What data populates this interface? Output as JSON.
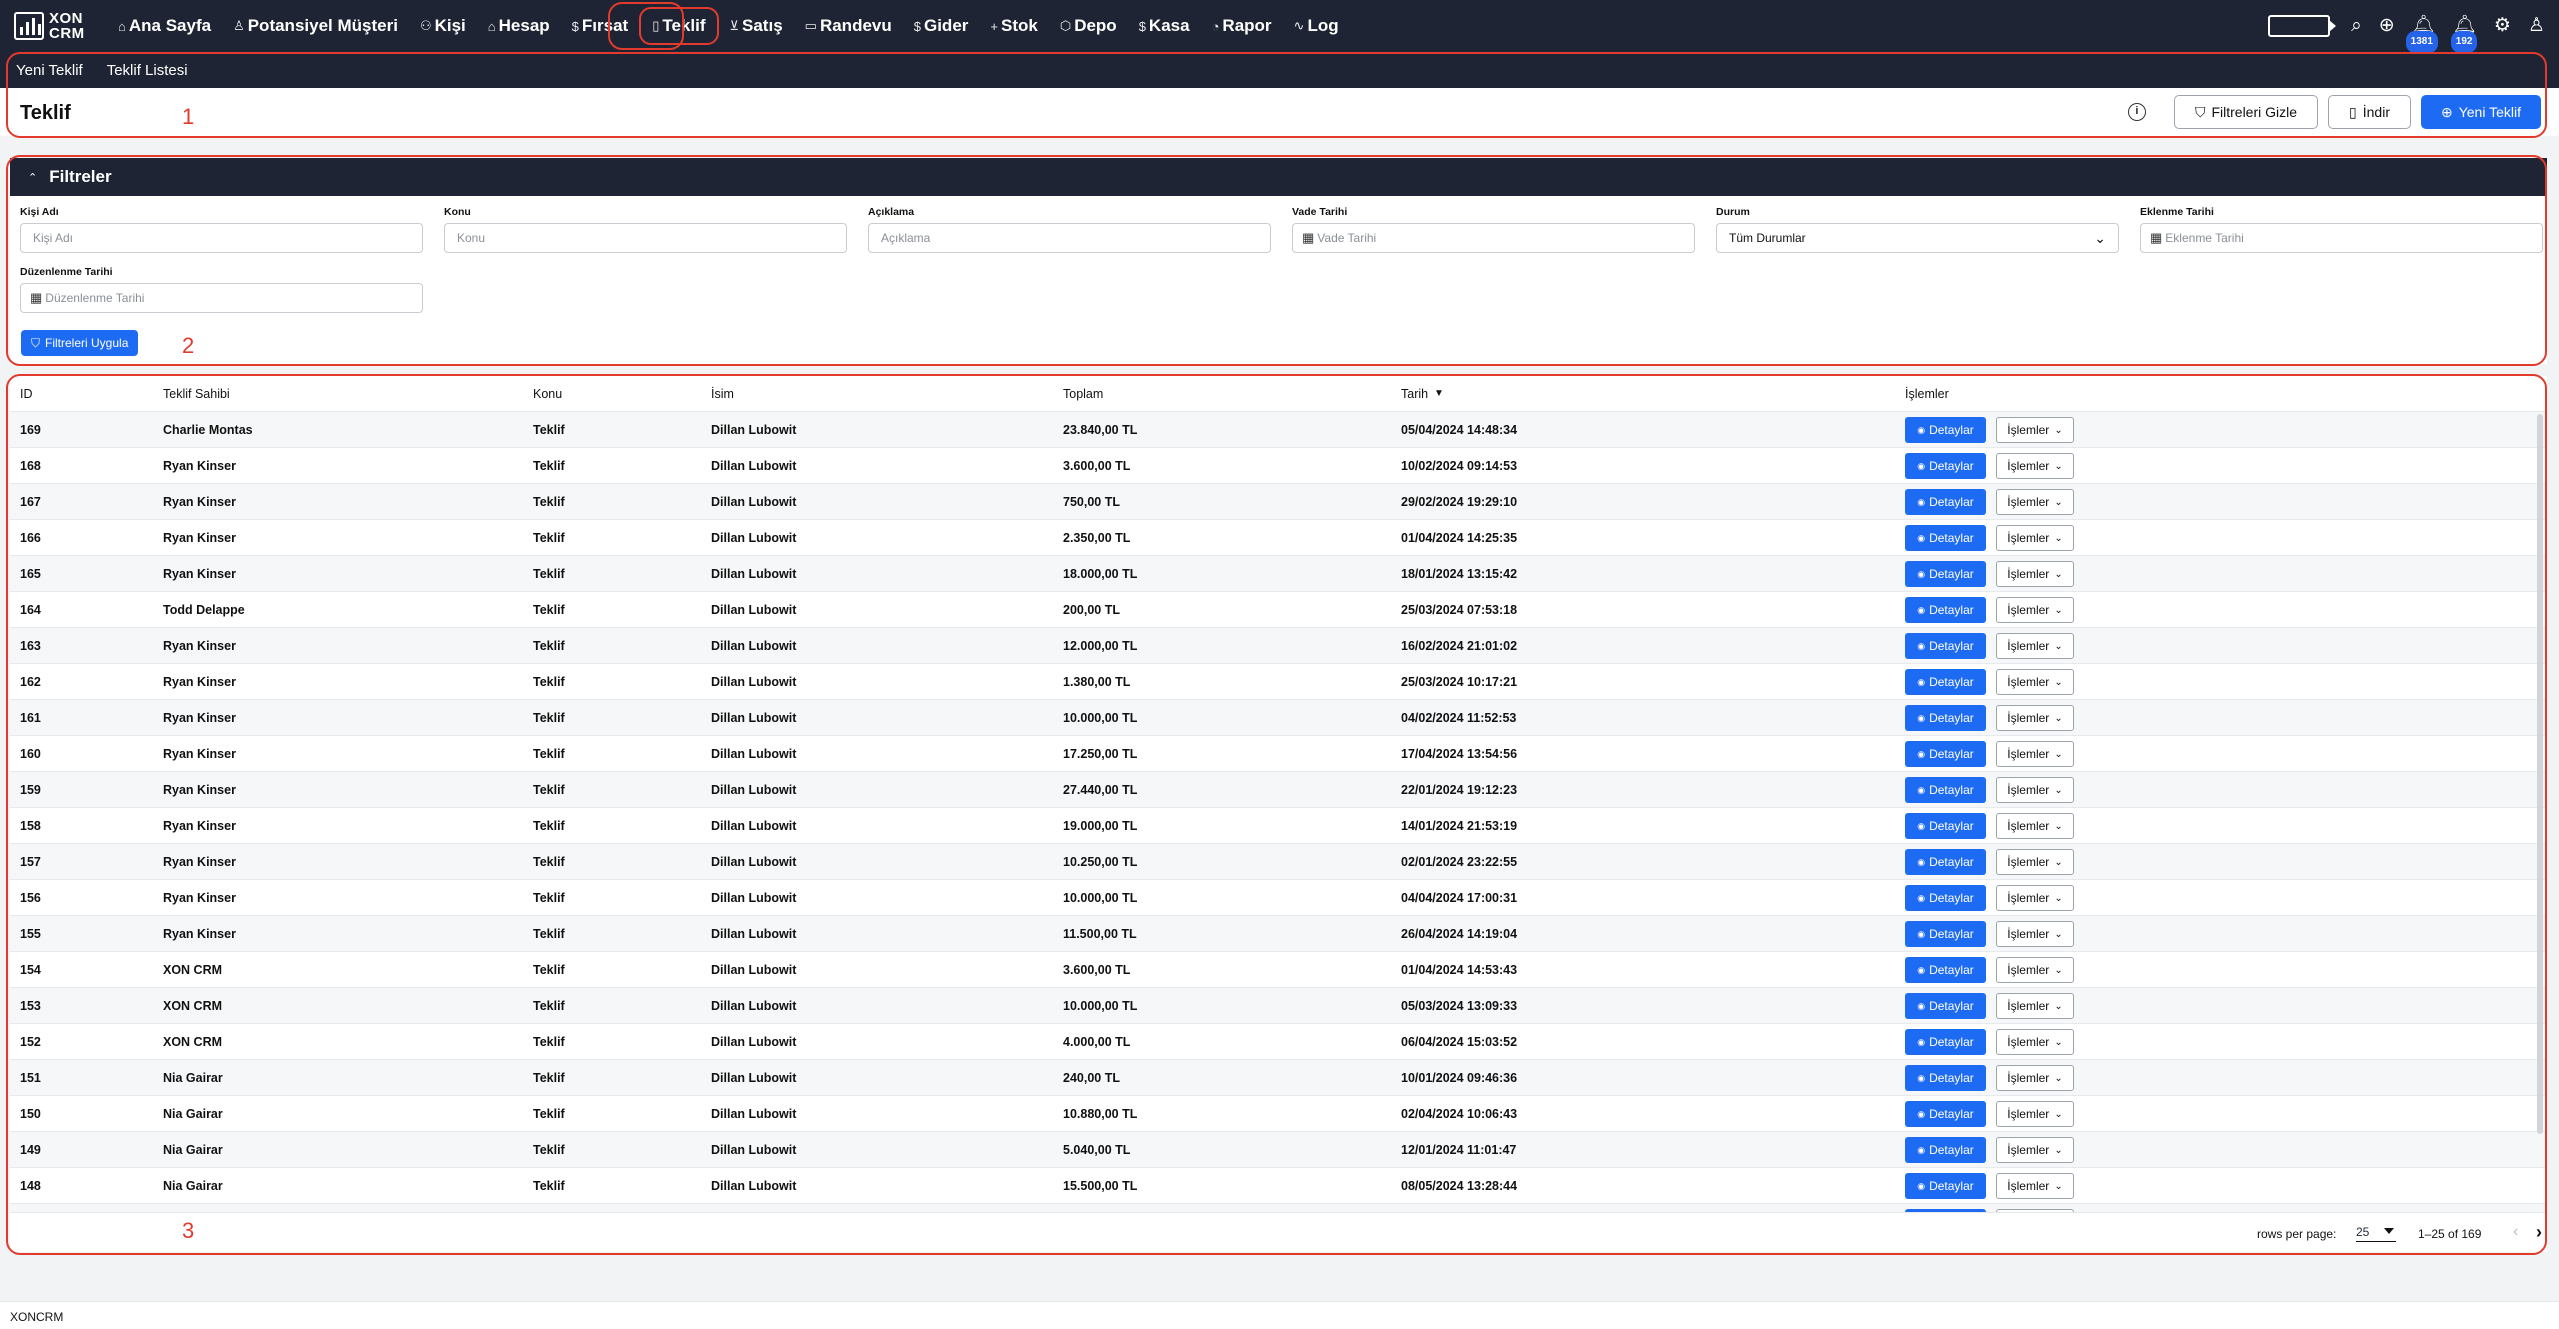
{
  "app": {
    "logo_text": "XON CRM",
    "logo_line1": "XON",
    "logo_line2": "CRM",
    "footer": "XONCRM"
  },
  "nav": [
    {
      "label": "Ana Sayfa",
      "icon": "home-icon",
      "glyph": "⌂"
    },
    {
      "label": "Potansiyel Müşteri",
      "icon": "user-icon",
      "glyph": "♙"
    },
    {
      "label": "Kişi",
      "icon": "users-icon",
      "glyph": "⚇"
    },
    {
      "label": "Hesap",
      "icon": "building-icon",
      "glyph": "⌂"
    },
    {
      "label": "Fırsat",
      "icon": "dollar-icon",
      "glyph": "$"
    },
    {
      "label": "Teklif",
      "icon": "document-icon",
      "glyph": "▯",
      "active": true
    },
    {
      "label": "Satış",
      "icon": "cart-icon",
      "glyph": "⊻"
    },
    {
      "label": "Randevu",
      "icon": "calendar-icon",
      "glyph": "▭"
    },
    {
      "label": "Gider",
      "icon": "dollar-icon",
      "glyph": "$"
    },
    {
      "label": "Stok",
      "icon": "plus-icon",
      "glyph": "+"
    },
    {
      "label": "Depo",
      "icon": "box-icon",
      "glyph": "⬡"
    },
    {
      "label": "Kasa",
      "icon": "dollar-icon",
      "glyph": "$"
    },
    {
      "label": "Rapor",
      "icon": "chart-icon",
      "glyph": "◔"
    },
    {
      "label": "Log",
      "icon": "activity-icon",
      "glyph": "∿"
    }
  ],
  "nav_right": {
    "badge1": "1381",
    "badge2": "192"
  },
  "subnav": {
    "new_quote": "Yeni Teklif",
    "quote_list": "Teklif Listesi"
  },
  "titlebar": {
    "title": "Teklif",
    "hide_filters": "Filtreleri Gizle",
    "download": "İndir",
    "new_quote": "Yeni Teklif"
  },
  "annotations": {
    "n1": "1",
    "n2": "2",
    "n3": "3"
  },
  "filters": {
    "title": "Filtreler",
    "fields": [
      {
        "label": "Kişi Adı",
        "placeholder": "Kişi Adı"
      },
      {
        "label": "Konu",
        "placeholder": "Konu"
      },
      {
        "label": "Açıklama",
        "placeholder": "Açıklama"
      },
      {
        "label": "Vade Tarihi",
        "placeholder": "Vade Tarihi",
        "date": true
      },
      {
        "label": "Durum",
        "value": "Tüm Durumlar",
        "select": true
      },
      {
        "label": "Eklenme Tarihi",
        "placeholder": "Eklenme Tarihi",
        "date": true
      },
      {
        "label": "Düzenlenme Tarihi",
        "placeholder": "Düzenlenme Tarihi",
        "date": true
      }
    ],
    "apply": "Filtreleri Uygula"
  },
  "table": {
    "columns": [
      "ID",
      "Teklif Sahibi",
      "Konu",
      "İsim",
      "Toplam",
      "Tarih",
      "İşlemler"
    ],
    "details_label": "Detaylar",
    "ops_label": "İşlemler",
    "rows": [
      [
        "169",
        "Charlie Montas",
        "Teklif",
        "Dillan Lubowit",
        "23.840,00 TL",
        "05/04/2024 14:48:34"
      ],
      [
        "168",
        "Ryan Kinser",
        "Teklif",
        "Dillan Lubowit",
        "3.600,00 TL",
        "10/02/2024 09:14:53"
      ],
      [
        "167",
        "Ryan Kinser",
        "Teklif",
        "Dillan Lubowit",
        "750,00 TL",
        "29/02/2024 19:29:10"
      ],
      [
        "166",
        "Ryan Kinser",
        "Teklif",
        "Dillan Lubowit",
        "2.350,00 TL",
        "01/04/2024 14:25:35"
      ],
      [
        "165",
        "Ryan Kinser",
        "Teklif",
        "Dillan Lubowit",
        "18.000,00 TL",
        "18/01/2024 13:15:42"
      ],
      [
        "164",
        "Todd Delappe",
        "Teklif",
        "Dillan Lubowit",
        "200,00 TL",
        "25/03/2024 07:53:18"
      ],
      [
        "163",
        "Ryan Kinser",
        "Teklif",
        "Dillan Lubowit",
        "12.000,00 TL",
        "16/02/2024 21:01:02"
      ],
      [
        "162",
        "Ryan Kinser",
        "Teklif",
        "Dillan Lubowit",
        "1.380,00 TL",
        "25/03/2024 10:17:21"
      ],
      [
        "161",
        "Ryan Kinser",
        "Teklif",
        "Dillan Lubowit",
        "10.000,00 TL",
        "04/02/2024 11:52:53"
      ],
      [
        "160",
        "Ryan Kinser",
        "Teklif",
        "Dillan Lubowit",
        "17.250,00 TL",
        "17/04/2024 13:54:56"
      ],
      [
        "159",
        "Ryan Kinser",
        "Teklif",
        "Dillan Lubowit",
        "27.440,00 TL",
        "22/01/2024 19:12:23"
      ],
      [
        "158",
        "Ryan Kinser",
        "Teklif",
        "Dillan Lubowit",
        "19.000,00 TL",
        "14/01/2024 21:53:19"
      ],
      [
        "157",
        "Ryan Kinser",
        "Teklif",
        "Dillan Lubowit",
        "10.250,00 TL",
        "02/01/2024 23:22:55"
      ],
      [
        "156",
        "Ryan Kinser",
        "Teklif",
        "Dillan Lubowit",
        "10.000,00 TL",
        "04/04/2024 17:00:31"
      ],
      [
        "155",
        "Ryan Kinser",
        "Teklif",
        "Dillan Lubowit",
        "11.500,00 TL",
        "26/04/2024 14:19:04"
      ],
      [
        "154",
        "XON CRM",
        "Teklif",
        "Dillan Lubowit",
        "3.600,00 TL",
        "01/04/2024 14:53:43"
      ],
      [
        "153",
        "XON CRM",
        "Teklif",
        "Dillan Lubowit",
        "10.000,00 TL",
        "05/03/2024 13:09:33"
      ],
      [
        "152",
        "XON CRM",
        "Teklif",
        "Dillan Lubowit",
        "4.000,00 TL",
        "06/04/2024 15:03:52"
      ],
      [
        "151",
        "Nia Gairar",
        "Teklif",
        "Dillan Lubowit",
        "240,00 TL",
        "10/01/2024 09:46:36"
      ],
      [
        "150",
        "Nia Gairar",
        "Teklif",
        "Dillan Lubowit",
        "10.880,00 TL",
        "02/04/2024 10:06:43"
      ],
      [
        "149",
        "Nia Gairar",
        "Teklif",
        "Dillan Lubowit",
        "5.040,00 TL",
        "12/01/2024 11:01:47"
      ],
      [
        "148",
        "Nia Gairar",
        "Teklif",
        "Dillan Lubowit",
        "15.500,00 TL",
        "08/05/2024 13:28:44"
      ]
    ],
    "footer": {
      "rows_per_page_label": "rows per page:",
      "rows_per_page": "25",
      "range": "1–25 of 169"
    }
  },
  "colors": {
    "navy": "#1e2433",
    "primary": "#1d6bf3",
    "annotation": "#e23b2e"
  }
}
